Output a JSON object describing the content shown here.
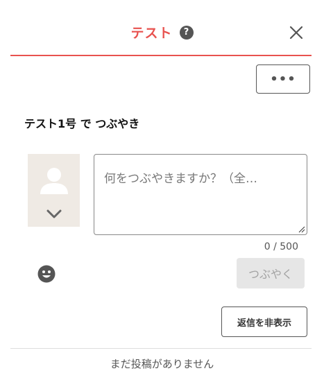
{
  "header": {
    "title": "テスト",
    "help_icon": "?",
    "accent_color": "#e8524f"
  },
  "toolbar": {
    "more_label": "•••"
  },
  "composer": {
    "post_as": "テスト1号 で つぶやき",
    "placeholder": "何をつぶやきますか？（全…",
    "counter": "0 / 500",
    "submit_label": "つぶやく"
  },
  "replies": {
    "hide_label": "返信を非表示"
  },
  "footer": {
    "text": "まだ投稿がありません"
  }
}
